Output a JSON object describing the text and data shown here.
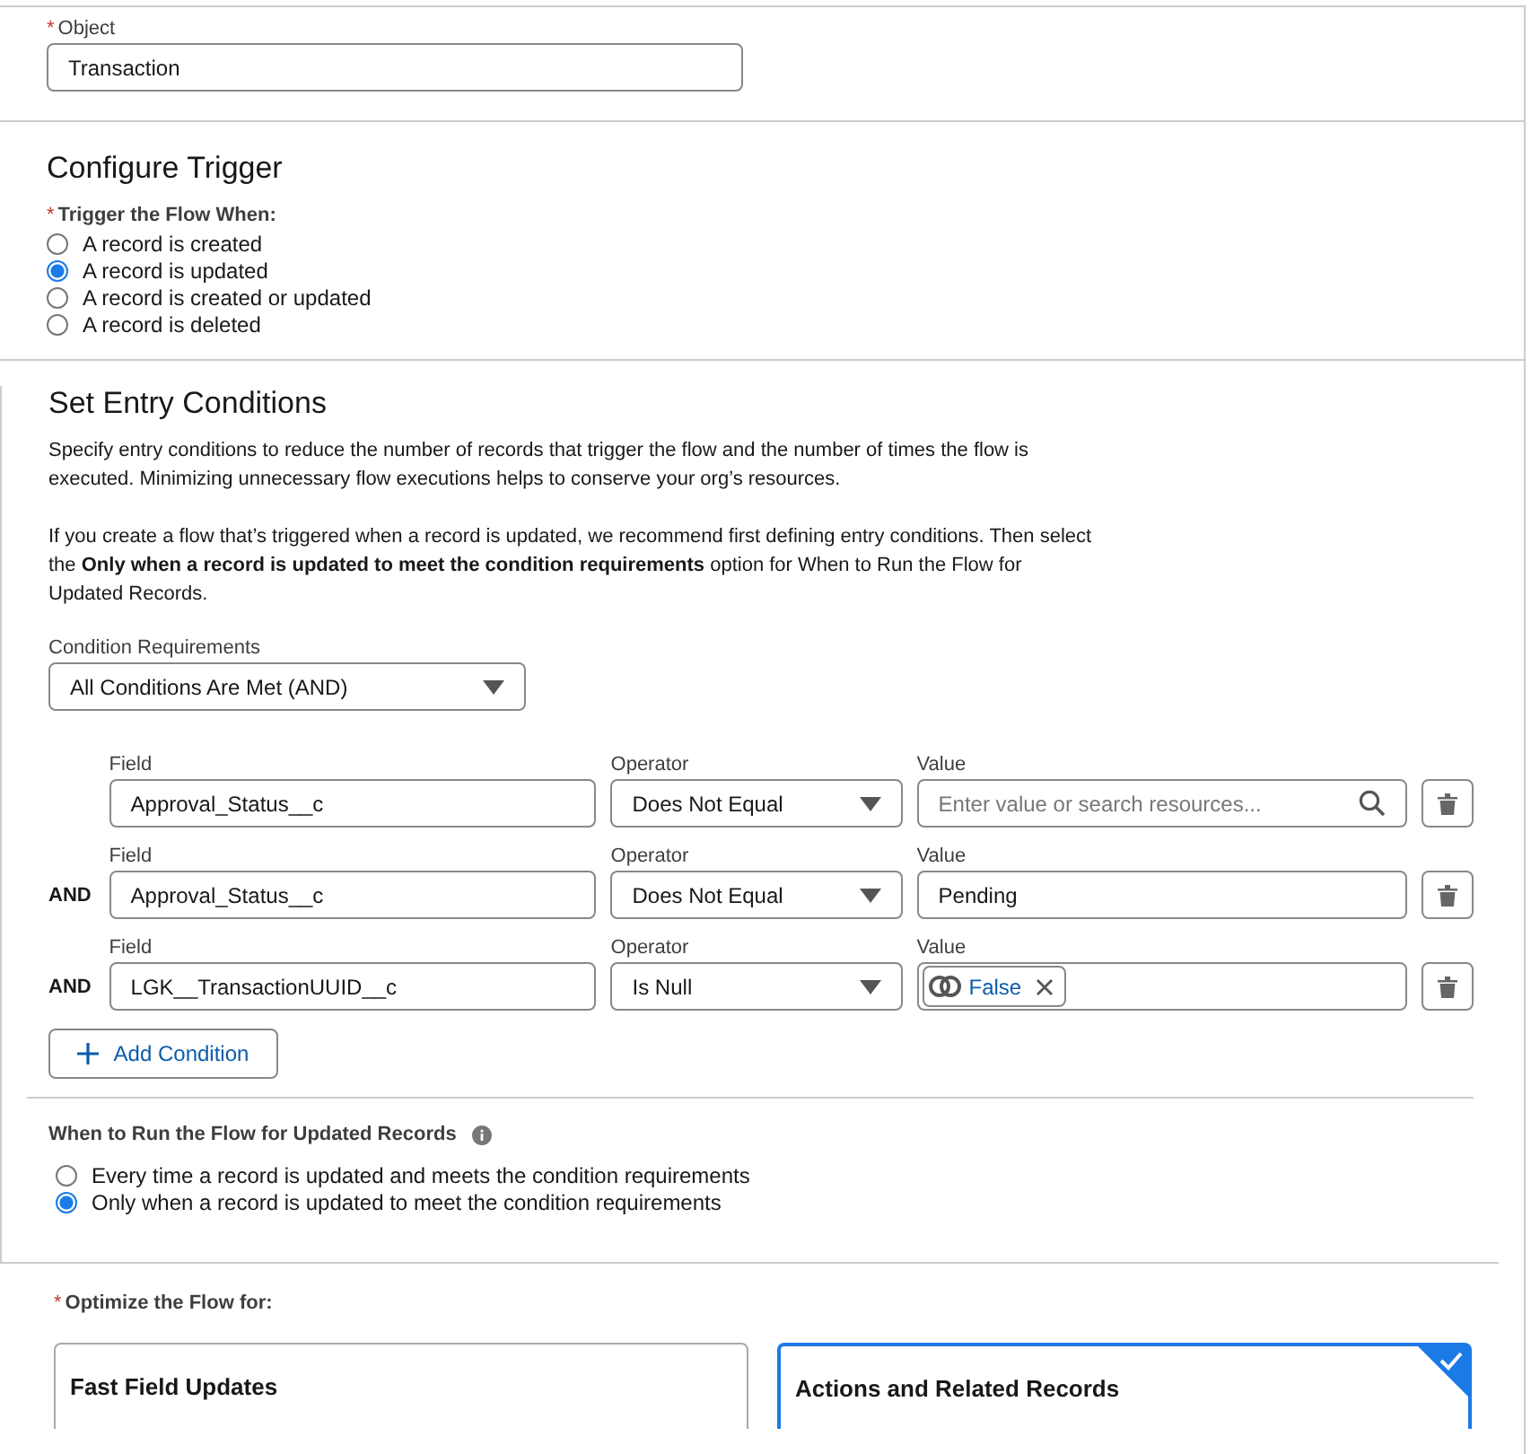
{
  "object_field": {
    "required_mark": "*",
    "label": "Object",
    "value": "Transaction"
  },
  "configure_trigger": {
    "title": "Configure Trigger",
    "required_mark": "*",
    "label": "Trigger the Flow When:",
    "options": [
      {
        "label": "A record is created",
        "selected": false
      },
      {
        "label": "A record is updated",
        "selected": true
      },
      {
        "label": "A record is created or updated",
        "selected": false
      },
      {
        "label": "A record is deleted",
        "selected": false
      }
    ]
  },
  "entry_conditions": {
    "title": "Set Entry Conditions",
    "paragraphs": [
      "Specify entry conditions to reduce the number of records that trigger the flow and the number of times the flow is executed. Minimizing unnecessary flow executions helps to conserve your org’s resources.",
      "If you create a flow that’s triggered when a record is updated, we recommend first defining entry conditions. Then select the **Only when a record is updated to meet the condition requirements** option for When to Run the Flow for Updated Records."
    ],
    "condition_requirements": {
      "label": "Condition Requirements",
      "value": "All Conditions Are Met (AND)"
    },
    "conditions": [
      {
        "field_label": "Field",
        "field": "Approval_Status__c",
        "operator_label": "Operator",
        "operator": "Does Not Equal",
        "value_label": "Value",
        "kind": "search",
        "placeholder": "Enter value or search resources..."
      },
      {
        "connector": "AND",
        "field_label": "Field",
        "field": "Approval_Status__c",
        "operator_label": "Operator",
        "operator": "Does Not Equal",
        "value_label": "Value",
        "kind": "text",
        "value": "Pending"
      },
      {
        "connector": "AND",
        "field_label": "Field",
        "field": "LGK__TransactionUUID__c",
        "operator_label": "Operator",
        "operator": "Is Null",
        "value_label": "Value",
        "kind": "pill",
        "value": "False"
      }
    ],
    "add_button": "Add Condition"
  },
  "when_to_run": {
    "label": "When to Run the Flow for Updated Records",
    "options": [
      {
        "label": "Every time a record is updated and meets the condition requirements",
        "selected": false
      },
      {
        "label": "Only when a record is updated to meet the condition requirements",
        "selected": true
      }
    ]
  },
  "optimize": {
    "required_mark": "*",
    "label": "Optimize the Flow for:",
    "cards": [
      {
        "title": "Fast Field Updates",
        "selected": false
      },
      {
        "title": "Actions and Related Records",
        "selected": true
      }
    ]
  }
}
